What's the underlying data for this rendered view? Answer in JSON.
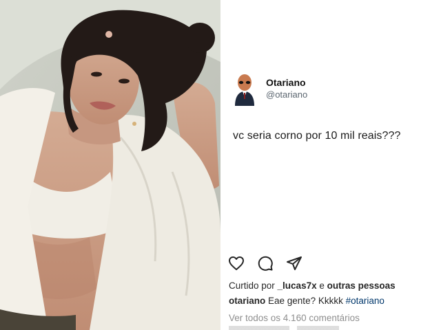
{
  "photo": {
    "alt": "",
    "colors": {
      "background": "#c9ccc3",
      "shirt": "#efece4",
      "hair": "#231a17",
      "skin": "#caa089"
    }
  },
  "post": {
    "author": {
      "name": "Otariano",
      "handle": "@otariano",
      "avatar_icon": "alien-in-suit-icon"
    },
    "text": "vc seria corno por 10 mil reais???"
  },
  "actions": {
    "icons": [
      "heart-icon",
      "comment-icon",
      "share-icon"
    ]
  },
  "likes": {
    "prefix": "Curtido por ",
    "user": "_lucas7x",
    "middle": " e ",
    "others": "outras pessoas"
  },
  "caption": {
    "user": "otariano",
    "text": " Eae gente? Kkkkk ",
    "hashtag": "#otariano"
  },
  "comments": {
    "view_all": "Ver todos os 4.160 comentários"
  },
  "colors": {
    "link": "#00376b",
    "muted": "#8e8e8e",
    "text": "#262626"
  }
}
